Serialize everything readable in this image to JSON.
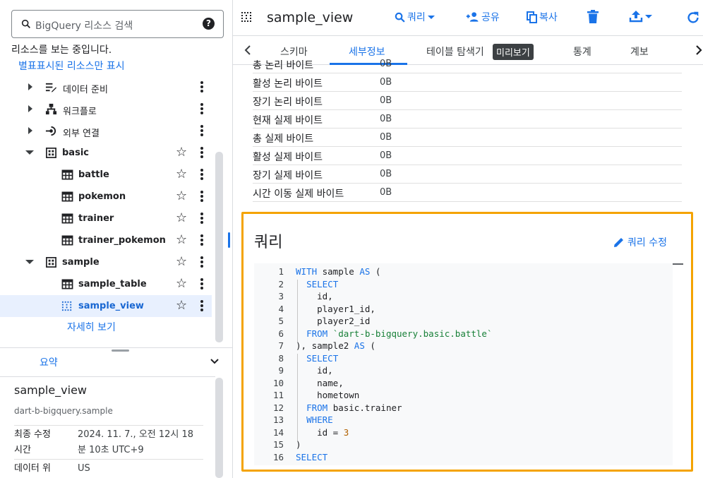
{
  "search": {
    "placeholder": "BigQuery 리소스 검색",
    "help": "?"
  },
  "browse_message": "리소스를 보는 중입니다.",
  "starred_link": "별표표시된 리소스만 표시",
  "tree": {
    "items": [
      {
        "label": "데이터 준비"
      },
      {
        "label": "워크플로"
      },
      {
        "label": "외부 연결"
      },
      {
        "label": "basic"
      },
      {
        "label": "battle"
      },
      {
        "label": "pokemon"
      },
      {
        "label": "trainer"
      },
      {
        "label": "trainer_pokemon"
      },
      {
        "label": "sample"
      },
      {
        "label": "sample_table"
      },
      {
        "label": "sample_view"
      }
    ],
    "more_link": "자세히 보기"
  },
  "summary": {
    "tab_label": "요약",
    "title": "sample_view",
    "path": "dart-b-bigquery.sample",
    "rows": [
      {
        "key": "최종 수정 시간",
        "key1": "최종 수정",
        "key2": "시간",
        "val1": "2024. 11. 7., 오전 12시 18",
        "val2": "분 10초 UTC+9"
      },
      {
        "key": "데이터 위",
        "val1": "US"
      }
    ]
  },
  "toolbar": {
    "title": "sample_view",
    "query": "쿼리",
    "share": "공유",
    "copy": "복사"
  },
  "tabs": {
    "schema": "스키마",
    "details": "세부정보",
    "table_explorer": "테이블 탐색기",
    "preview_tooltip": "미리보기",
    "stats": "통계",
    "lineage": "계보"
  },
  "stats_rows": [
    {
      "key": "총 논리 바이트",
      "value": "0B"
    },
    {
      "key": "활성 논리 바이트",
      "value": "0B"
    },
    {
      "key": "장기 논리 바이트",
      "value": "0B"
    },
    {
      "key": "현재 실제 바이트",
      "value": "0B"
    },
    {
      "key": "총 실제 바이트",
      "value": "0B"
    },
    {
      "key": "활성 실제 바이트",
      "value": "0B"
    },
    {
      "key": "장기 실제 바이트",
      "value": "0B"
    },
    {
      "key": "시간 이동 실제 바이트",
      "value": "0B"
    }
  ],
  "query_card": {
    "title": "쿼리",
    "edit_label": "쿼리 수정",
    "lines": [
      {
        "n": "1",
        "segs": [
          [
            "kw",
            "WITH"
          ],
          [
            "t",
            " sample "
          ],
          [
            "kw",
            "AS"
          ],
          [
            "t",
            " ("
          ]
        ]
      },
      {
        "n": "2",
        "segs": [
          [
            "t",
            "  "
          ],
          [
            "kw",
            "SELECT"
          ]
        ]
      },
      {
        "n": "3",
        "segs": [
          [
            "t",
            "    id,"
          ]
        ]
      },
      {
        "n": "4",
        "segs": [
          [
            "t",
            "    player1_id,"
          ]
        ]
      },
      {
        "n": "5",
        "segs": [
          [
            "t",
            "    player2_id"
          ]
        ]
      },
      {
        "n": "6",
        "segs": [
          [
            "t",
            "  "
          ],
          [
            "kw",
            "FROM"
          ],
          [
            "t",
            " "
          ],
          [
            "str",
            "`dart-b-bigquery.basic.battle`"
          ]
        ]
      },
      {
        "n": "7",
        "segs": [
          [
            "t",
            "), sample2 "
          ],
          [
            "kw",
            "AS"
          ],
          [
            "t",
            " ("
          ]
        ]
      },
      {
        "n": "8",
        "segs": [
          [
            "t",
            "  "
          ],
          [
            "kw",
            "SELECT"
          ]
        ]
      },
      {
        "n": "9",
        "segs": [
          [
            "t",
            "    id,"
          ]
        ]
      },
      {
        "n": "10",
        "segs": [
          [
            "t",
            "    name,"
          ]
        ]
      },
      {
        "n": "11",
        "segs": [
          [
            "t",
            "    hometown"
          ]
        ]
      },
      {
        "n": "12",
        "segs": [
          [
            "t",
            "  "
          ],
          [
            "kw",
            "FROM"
          ],
          [
            "t",
            " basic.trainer"
          ]
        ]
      },
      {
        "n": "13",
        "segs": [
          [
            "t",
            "  "
          ],
          [
            "kw",
            "WHERE"
          ]
        ]
      },
      {
        "n": "14",
        "segs": [
          [
            "t",
            "    id = "
          ],
          [
            "num",
            "3"
          ]
        ]
      },
      {
        "n": "15",
        "segs": [
          [
            "t",
            ")"
          ]
        ]
      },
      {
        "n": "16",
        "segs": [
          [
            "kw",
            "SELECT"
          ]
        ]
      }
    ]
  },
  "colors": {
    "accent": "#1a73e8",
    "highlight_border": "#f4a300",
    "keyword": "#1a73e8",
    "string": "#188038",
    "number": "#b06000"
  }
}
